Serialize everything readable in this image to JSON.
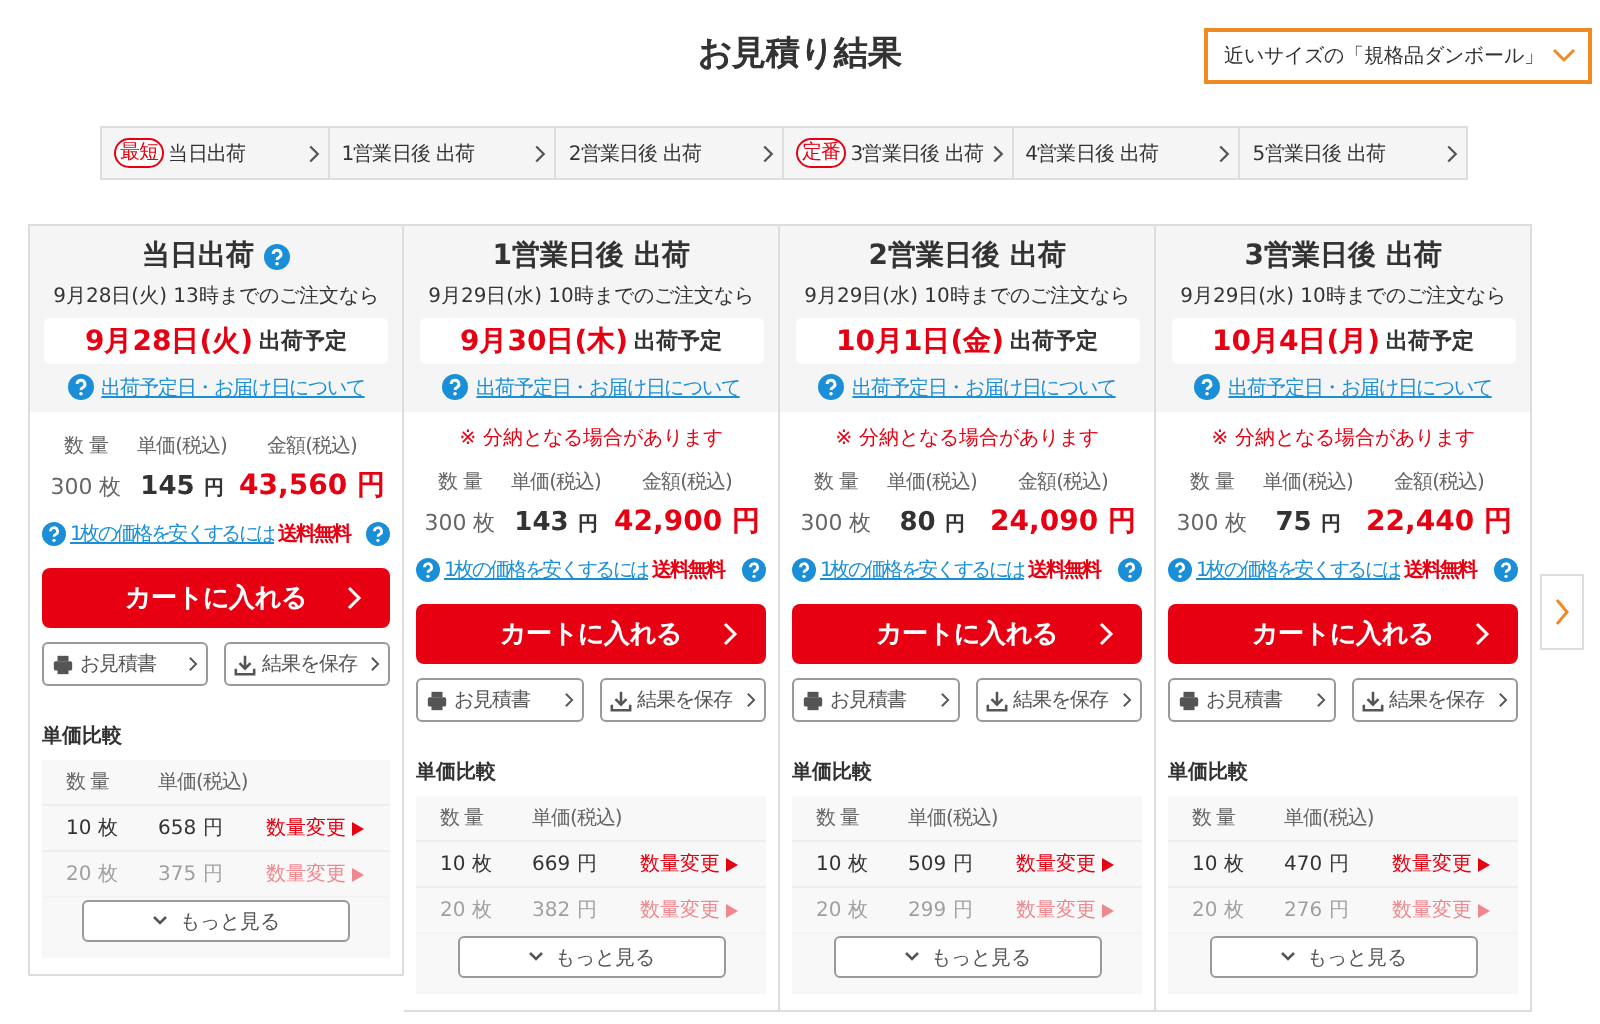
{
  "title": "お見積り結果",
  "size_dropdown": {
    "value": "近いサイズの「規格品ダンボール」"
  },
  "tabs": [
    {
      "badge": "最短",
      "label": "当日出荷"
    },
    {
      "label": "1営業日後 出荷"
    },
    {
      "label": "2営業日後 出荷"
    },
    {
      "badge": "定番",
      "label": "3営業日後 出荷"
    },
    {
      "label": "4営業日後 出荷"
    },
    {
      "label": "5営業日後 出荷"
    }
  ],
  "cards": [
    {
      "title": "当日出荷",
      "help": true,
      "deadline": "9月28日(火) 13時までのご注文なら",
      "ship_date": "9月28日(火)",
      "ship_suffix": "出荷予定",
      "date_link": "出荷予定日・お届け日について",
      "quantity_label": "数 量",
      "unit_label": "単価(税込)",
      "total_label": "金額(税込)",
      "quantity": "300 枚",
      "unit_price": "145",
      "unit_yen": "円",
      "total": "43,560 円",
      "cheaper_link": "1枚の価格を安くするには",
      "shipping": "送料無料",
      "cart_button": "カートに入れる",
      "quote_button": "お見積書",
      "save_button": "結果を保存",
      "compare_title": "単価比較",
      "compare_qty_label": "数 量",
      "compare_unit_label": "単価(税込)",
      "compare_rows": [
        {
          "qty": "10 枚",
          "price": "658 円",
          "action": "数量変更",
          "faded": false
        },
        {
          "qty": "20 枚",
          "price": "375 円",
          "action": "数量変更",
          "faded": true
        }
      ],
      "more_button": "もっと見る"
    },
    {
      "title": "1営業日後 出荷",
      "help": false,
      "deadline": "9月29日(水) 10時までのご注文なら",
      "ship_date": "9月30日(木)",
      "ship_suffix": "出荷予定",
      "date_link": "出荷予定日・お届け日について",
      "notice": "※ 分納となる場合があります",
      "quantity_label": "数 量",
      "unit_label": "単価(税込)",
      "total_label": "金額(税込)",
      "quantity": "300 枚",
      "unit_price": "143",
      "unit_yen": "円",
      "total": "42,900 円",
      "cheaper_link": "1枚の価格を安くするには",
      "shipping": "送料無料",
      "cart_button": "カートに入れる",
      "quote_button": "お見積書",
      "save_button": "結果を保存",
      "compare_title": "単価比較",
      "compare_qty_label": "数 量",
      "compare_unit_label": "単価(税込)",
      "compare_rows": [
        {
          "qty": "10 枚",
          "price": "669 円",
          "action": "数量変更",
          "faded": false
        },
        {
          "qty": "20 枚",
          "price": "382 円",
          "action": "数量変更",
          "faded": true
        }
      ],
      "more_button": "もっと見る"
    },
    {
      "title": "2営業日後 出荷",
      "help": false,
      "deadline": "9月29日(水) 10時までのご注文なら",
      "ship_date": "10月1日(金)",
      "ship_suffix": "出荷予定",
      "date_link": "出荷予定日・お届け日について",
      "notice": "※ 分納となる場合があります",
      "quantity_label": "数 量",
      "unit_label": "単価(税込)",
      "total_label": "金額(税込)",
      "quantity": "300 枚",
      "unit_price": "80",
      "unit_yen": "円",
      "total": "24,090 円",
      "cheaper_link": "1枚の価格を安くするには",
      "shipping": "送料無料",
      "cart_button": "カートに入れる",
      "quote_button": "お見積書",
      "save_button": "結果を保存",
      "compare_title": "単価比較",
      "compare_qty_label": "数 量",
      "compare_unit_label": "単価(税込)",
      "compare_rows": [
        {
          "qty": "10 枚",
          "price": "509 円",
          "action": "数量変更",
          "faded": false
        },
        {
          "qty": "20 枚",
          "price": "299 円",
          "action": "数量変更",
          "faded": true
        }
      ],
      "more_button": "もっと見る"
    },
    {
      "title": "3営業日後 出荷",
      "help": false,
      "deadline": "9月29日(水) 10時までのご注文なら",
      "ship_date": "10月4日(月)",
      "ship_suffix": "出荷予定",
      "date_link": "出荷予定日・お届け日について",
      "notice": "※ 分納となる場合があります",
      "quantity_label": "数 量",
      "unit_label": "単価(税込)",
      "total_label": "金額(税込)",
      "quantity": "300 枚",
      "unit_price": "75",
      "unit_yen": "円",
      "total": "22,440 円",
      "cheaper_link": "1枚の価格を安くするには",
      "shipping": "送料無料",
      "cart_button": "カートに入れる",
      "quote_button": "お見積書",
      "save_button": "結果を保存",
      "compare_title": "単価比較",
      "compare_qty_label": "数 量",
      "compare_unit_label": "単価(税込)",
      "compare_rows": [
        {
          "qty": "10 枚",
          "price": "470 円",
          "action": "数量変更",
          "faded": false
        },
        {
          "qty": "20 枚",
          "price": "276 円",
          "action": "数量変更",
          "faded": true
        }
      ],
      "more_button": "もっと見る"
    }
  ]
}
